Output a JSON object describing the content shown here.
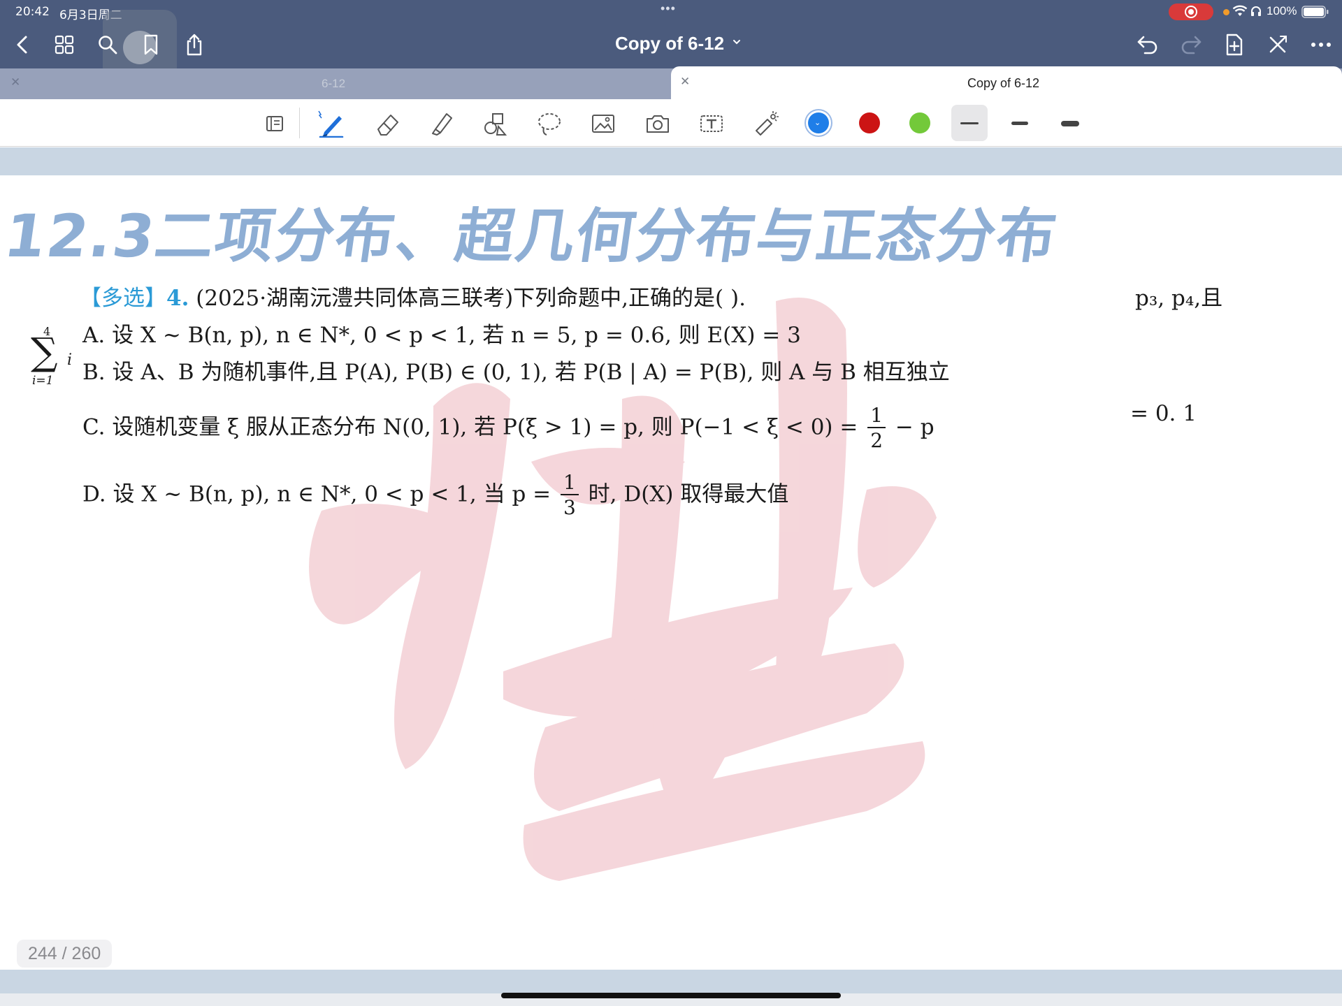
{
  "status_bar": {
    "time": "20:42",
    "date": "6月3日周二",
    "battery": "100%"
  },
  "navbar": {
    "title": "Copy of 6-12",
    "icons": [
      "back-icon",
      "grid-icon",
      "search-icon",
      "bookmark-icon",
      "share-icon",
      "undo-icon",
      "redo-icon",
      "add-page-icon",
      "close-icon",
      "more-icon"
    ]
  },
  "tabs": [
    {
      "label": "6-12",
      "active": false
    },
    {
      "label": "Copy of 6-12",
      "active": true
    }
  ],
  "toolbar": {
    "tools": [
      "read-mode-icon",
      "pen-icon",
      "eraser-icon",
      "highlighter-icon",
      "shapes-icon",
      "lasso-icon",
      "image-icon",
      "camera-icon",
      "text-icon",
      "laser-pointer-icon"
    ],
    "colors": [
      "#1f7ee8",
      "#cc1414",
      "#73c93a"
    ],
    "selected_color": "#1f7ee8",
    "stroke_widths": [
      "thin",
      "medium",
      "thick"
    ],
    "selected_stroke": "thin"
  },
  "page": {
    "heading": "12.3二项分布、超几何分布与正态分布",
    "question": {
      "tag": "【多选】",
      "number": "4.",
      "stem": "(2025·湖南沅澧共同体高三联考)下列命题中,正确的是(            ).",
      "options": {
        "A": {
          "label": "A.",
          "text_1": "设",
          "text_2": "X ~ B(n, p), n ∈ N*, 0 < p < 1, 若 n = 5, p = 0.6, 则 E(X) = 3"
        },
        "B": {
          "label": "B.",
          "text": "设 A、B 为随机事件,且 P(A), P(B) ∈ (0, 1), 若 P(B | A) = P(B), 则 A 与 B 相互独立"
        },
        "C": {
          "label": "C.",
          "text_before": "设随机变量 ξ 服从正态分布 N(0, 1), 若 P(ξ > 1) = p, 则 P(−1 < ξ < 0) =",
          "frac_num": "1",
          "frac_den": "2",
          "text_after": "− p"
        },
        "D": {
          "label": "D.",
          "text_before": "设 X ~ B(n, p), n ∈ N*, 0 < p < 1, 当 p =",
          "frac_num": "1",
          "frac_den": "3",
          "text_after": "时, D(X) 取得最大值"
        }
      }
    },
    "side_right_1": "p₃, p₄,且",
    "side_right_2": "= 0. 1",
    "sigma": {
      "top": "4",
      "symbol": "∑",
      "sub": "i=1",
      "trail": "i"
    },
    "page_indicator": "244 / 260"
  }
}
